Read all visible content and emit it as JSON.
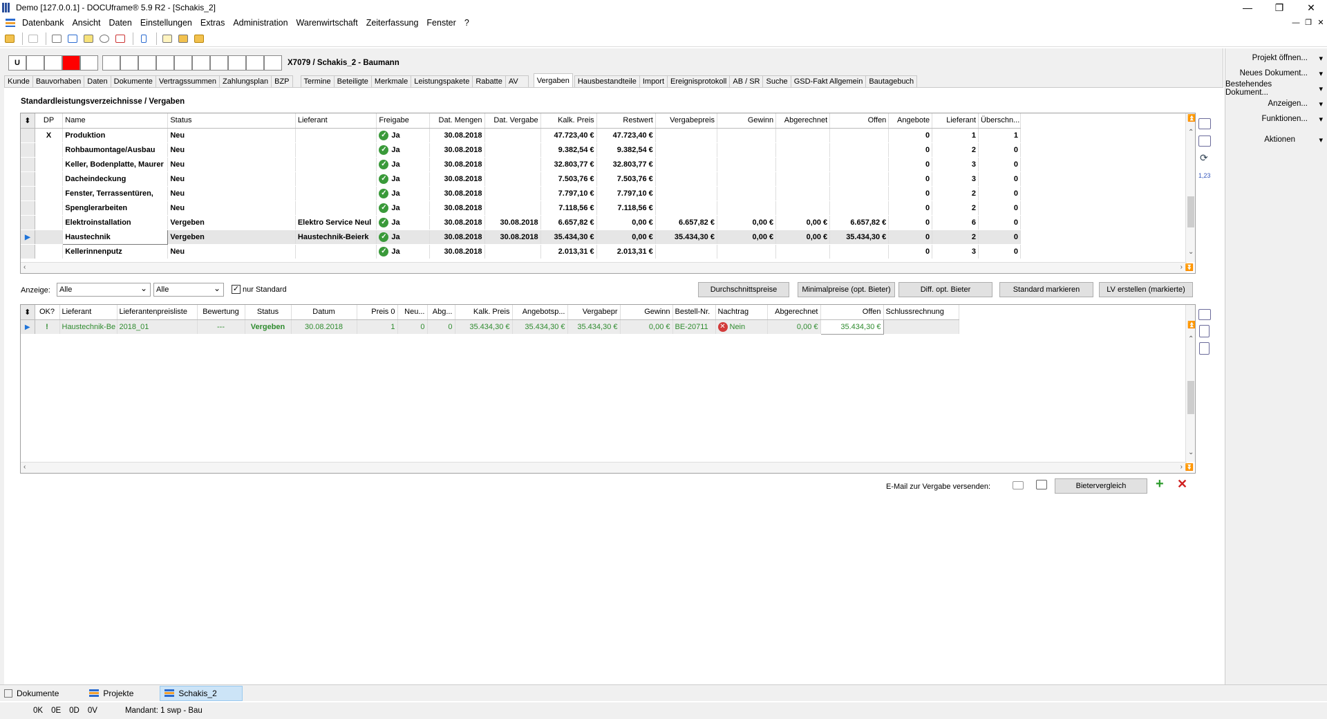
{
  "window": {
    "title": "Demo [127.0.0.1] - DOCUframe® 5.9 R2 - [Schakis_2]",
    "controls": [
      "—",
      "❐",
      "✕"
    ],
    "mdi_controls": [
      "—",
      "❐",
      "✕"
    ]
  },
  "menu": [
    "Datenbank",
    "Ansicht",
    "Daten",
    "Einstellungen",
    "Extras",
    "Administration",
    "Warenwirtschaft",
    "Zeiterfassung",
    "Fenster",
    "?"
  ],
  "status_boxes": [
    "U",
    "",
    "",
    "",
    "",
    "",
    "",
    "",
    "",
    "",
    "",
    "",
    "",
    "",
    "",
    ""
  ],
  "project_title": "X7079 / Schakis_2 - Baumann",
  "tabs": [
    "Kunde",
    "Bauvorhaben",
    "Daten",
    "Dokumente",
    "Vertragssummen",
    "Zahlungsplan",
    "BZP",
    "Termine",
    "Beteiligte",
    "Merkmale",
    "Leistungspakete",
    "Rabatte",
    "AV"
  ],
  "active_tab": "Vergaben",
  "tabs_after": [
    "Hausbestandteile",
    "Import",
    "Ereignisprotokoll",
    "AB / SR",
    "Suche",
    "GSD-Fakt Allgemein",
    "Bautagebuch"
  ],
  "section_title": "Standardleistungsverzeichnisse / Vergaben",
  "upper_grid": {
    "columns": [
      "",
      "DP",
      "Name",
      "Status",
      "Lieferant",
      "Freigabe",
      "Dat. Mengen",
      "Dat. Vergabe",
      "Kalk. Preis",
      "Restwert",
      "Vergabepreis",
      "Gewinn",
      "Abgerechnet",
      "Offen",
      "Angebote",
      "Lieferant",
      "Überschn..."
    ],
    "rows": [
      [
        "",
        "X",
        "Produktion",
        "Neu",
        "",
        "Ja",
        "30.08.2018",
        "",
        "47.723,40 €",
        "47.723,40 €",
        "",
        "",
        "",
        "",
        "0",
        "1",
        "1"
      ],
      [
        "",
        "",
        "Rohbaumontage/Ausbau",
        "Neu",
        "",
        "Ja",
        "30.08.2018",
        "",
        "9.382,54 €",
        "9.382,54 €",
        "",
        "",
        "",
        "",
        "0",
        "2",
        "0"
      ],
      [
        "",
        "",
        "Keller, Bodenplatte, Maurer",
        "Neu",
        "",
        "Ja",
        "30.08.2018",
        "",
        "32.803,77 €",
        "32.803,77 €",
        "",
        "",
        "",
        "",
        "0",
        "3",
        "0"
      ],
      [
        "",
        "",
        "Dacheindeckung",
        "Neu",
        "",
        "Ja",
        "30.08.2018",
        "",
        "7.503,76 €",
        "7.503,76 €",
        "",
        "",
        "",
        "",
        "0",
        "3",
        "0"
      ],
      [
        "",
        "",
        "Fenster, Terrassentüren, ",
        "Neu",
        "",
        "Ja",
        "30.08.2018",
        "",
        "7.797,10 €",
        "7.797,10 €",
        "",
        "",
        "",
        "",
        "0",
        "2",
        "0"
      ],
      [
        "",
        "",
        "Spenglerarbeiten",
        "Neu",
        "",
        "Ja",
        "30.08.2018",
        "",
        "7.118,56 €",
        "7.118,56 €",
        "",
        "",
        "",
        "",
        "0",
        "2",
        "0"
      ],
      [
        "",
        "",
        "Elektroinstallation",
        "Vergeben",
        "Elektro Service Neul",
        "Ja",
        "30.08.2018",
        "30.08.2018",
        "6.657,82 €",
        "0,00 €",
        "6.657,82 €",
        "0,00 €",
        "0,00 €",
        "6.657,82 €",
        "0",
        "6",
        "0"
      ],
      [
        "▶",
        "",
        "Haustechnik",
        "Vergeben",
        "Haustechnik-Beierk",
        "Ja",
        "30.08.2018",
        "30.08.2018",
        "35.434,30 €",
        "0,00 €",
        "35.434,30 €",
        "0,00 €",
        "0,00 €",
        "35.434,30 €",
        "0",
        "2",
        "0"
      ],
      [
        "",
        "",
        "Kellerinnenputz",
        "Neu",
        "",
        "Ja",
        "30.08.2018",
        "",
        "2.013,31 €",
        "2.013,31 €",
        "",
        "",
        "",
        "",
        "0",
        "3",
        "0"
      ]
    ],
    "selected_row": 7
  },
  "filter": {
    "label": "Anzeige:",
    "select1": "Alle",
    "select2": "Alle",
    "checkbox_label": "nur Standard",
    "checked": true
  },
  "buttons": {
    "durchschnitt": "Durchschnittspreise",
    "minimal": "Minimalpreise (opt. Bieter)",
    "diff": "Diff. opt. Bieter",
    "standard": "Standard markieren",
    "lv": "LV erstellen (markierte)"
  },
  "lower_grid": {
    "columns": [
      "",
      "OK?",
      "Lieferant",
      "Lieferantenpreisliste",
      "Bewertung",
      "Status",
      "Datum",
      "Preis 0",
      "Neu...",
      "Abg...",
      "Kalk. Preis",
      "Angebotsp...",
      "Vergabepr",
      "Gewinn",
      "Bestell-Nr.",
      "Nachtrag",
      "Abgerechnet",
      "Offen",
      "Schlussrechnung"
    ],
    "rows": [
      [
        "▶",
        "!",
        "Haustechnik-Be",
        "2018_01",
        "---",
        "Vergeben",
        "30.08.2018",
        "1",
        "0",
        "0",
        "35.434,30 €",
        "35.434,30 €",
        "35.434,30 €",
        "0,00 €",
        "BE-20711",
        "Nein",
        "0,00 €",
        "35.434,30 €",
        ""
      ]
    ]
  },
  "email_label": "E-Mail zur Vergabe versenden:",
  "bietervergleich": "Bietervergleich",
  "side_label": "1,23",
  "right_panel": [
    "Projekt öffnen...",
    "Neues Dokument...",
    "Bestehendes Dokument...",
    "Anzeigen...",
    "Funktionen...",
    "Aktionen"
  ],
  "bottom_tabs": [
    "Dokumente",
    "Projekte",
    "Schakis_2"
  ],
  "statusbar": [
    "0K",
    "0E",
    "0D",
    "0V",
    "Mandant: 1 swp - Bau"
  ]
}
